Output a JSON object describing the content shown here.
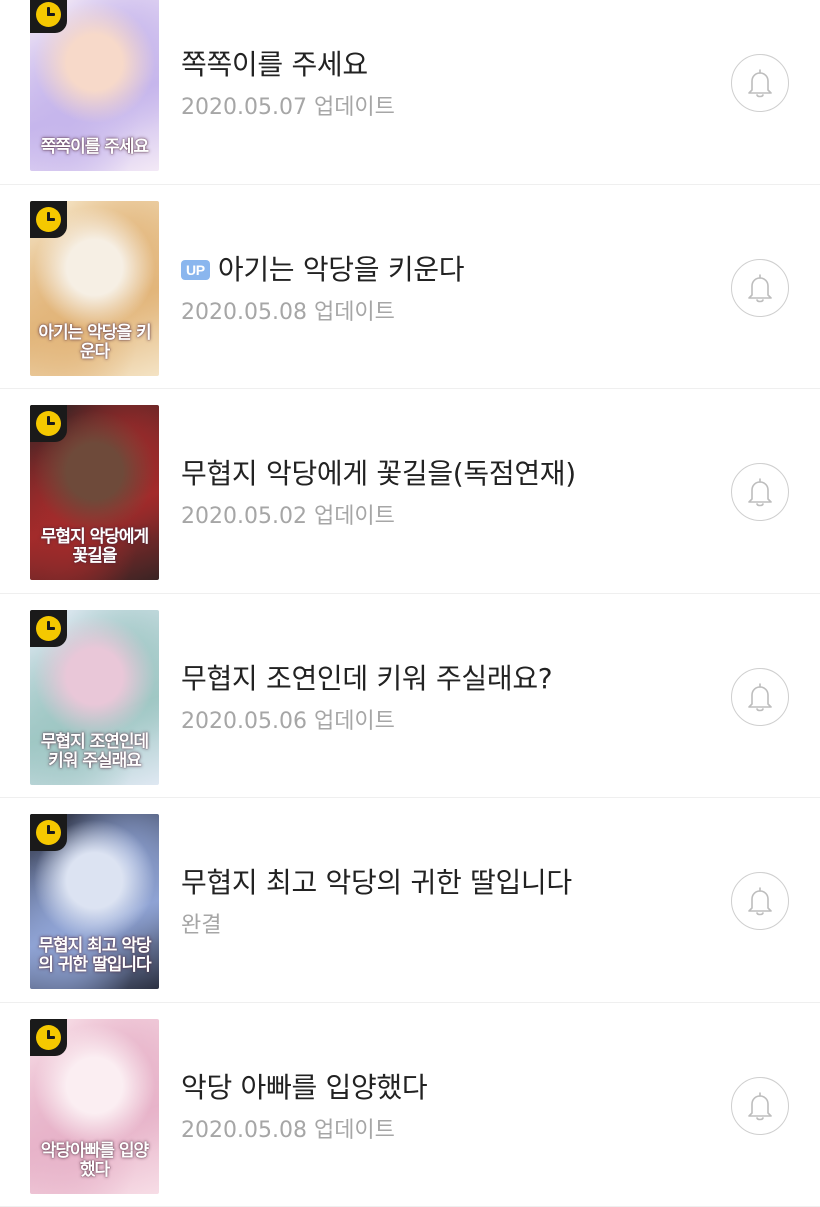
{
  "items": [
    {
      "title": "쪽쪽이를 주세요",
      "up": false,
      "subtitle": "2020.05.07 업데이트",
      "cover_text": "쪽쪽이를 주세요",
      "cover_colors": [
        "#f3e9f6",
        "#c6b6ec",
        "#f7d9c9"
      ]
    },
    {
      "title": "아기는 악당을 키운다",
      "up": true,
      "up_label": "UP",
      "subtitle": "2020.05.08 업데이트",
      "cover_text": "아기는 악당을 키운다",
      "cover_colors": [
        "#f4e3c4",
        "#e2b57a",
        "#f6efe4"
      ]
    },
    {
      "title": "무협지 악당에게 꽃길을(독점연재)",
      "up": false,
      "subtitle": "2020.05.02 업데이트",
      "cover_text": "무협지 악당에게 꽃길을",
      "cover_colors": [
        "#3a2424",
        "#a32b2b",
        "#6e4a3a"
      ]
    },
    {
      "title": "무협지 조연인데 키워 주실래요?",
      "up": false,
      "subtitle": "2020.05.06 업데이트",
      "cover_text": "무협지 조연인데 키워 주실래요",
      "cover_colors": [
        "#dfe8f2",
        "#9fc7c4",
        "#e9c7d8"
      ]
    },
    {
      "title": "무협지 최고 악당의 귀한 딸입니다",
      "up": false,
      "subtitle": "완결",
      "cover_text": "무협지 최고 악당의 귀한 딸입니다",
      "cover_colors": [
        "#2c3142",
        "#8fa3d4",
        "#dce3f2"
      ]
    },
    {
      "title": "악당 아빠를 입양했다",
      "up": false,
      "subtitle": "2020.05.08 업데이트",
      "cover_text": "악당아빠를 입양했다",
      "cover_colors": [
        "#f7dde6",
        "#e7b3c9",
        "#fbeef2"
      ]
    }
  ]
}
